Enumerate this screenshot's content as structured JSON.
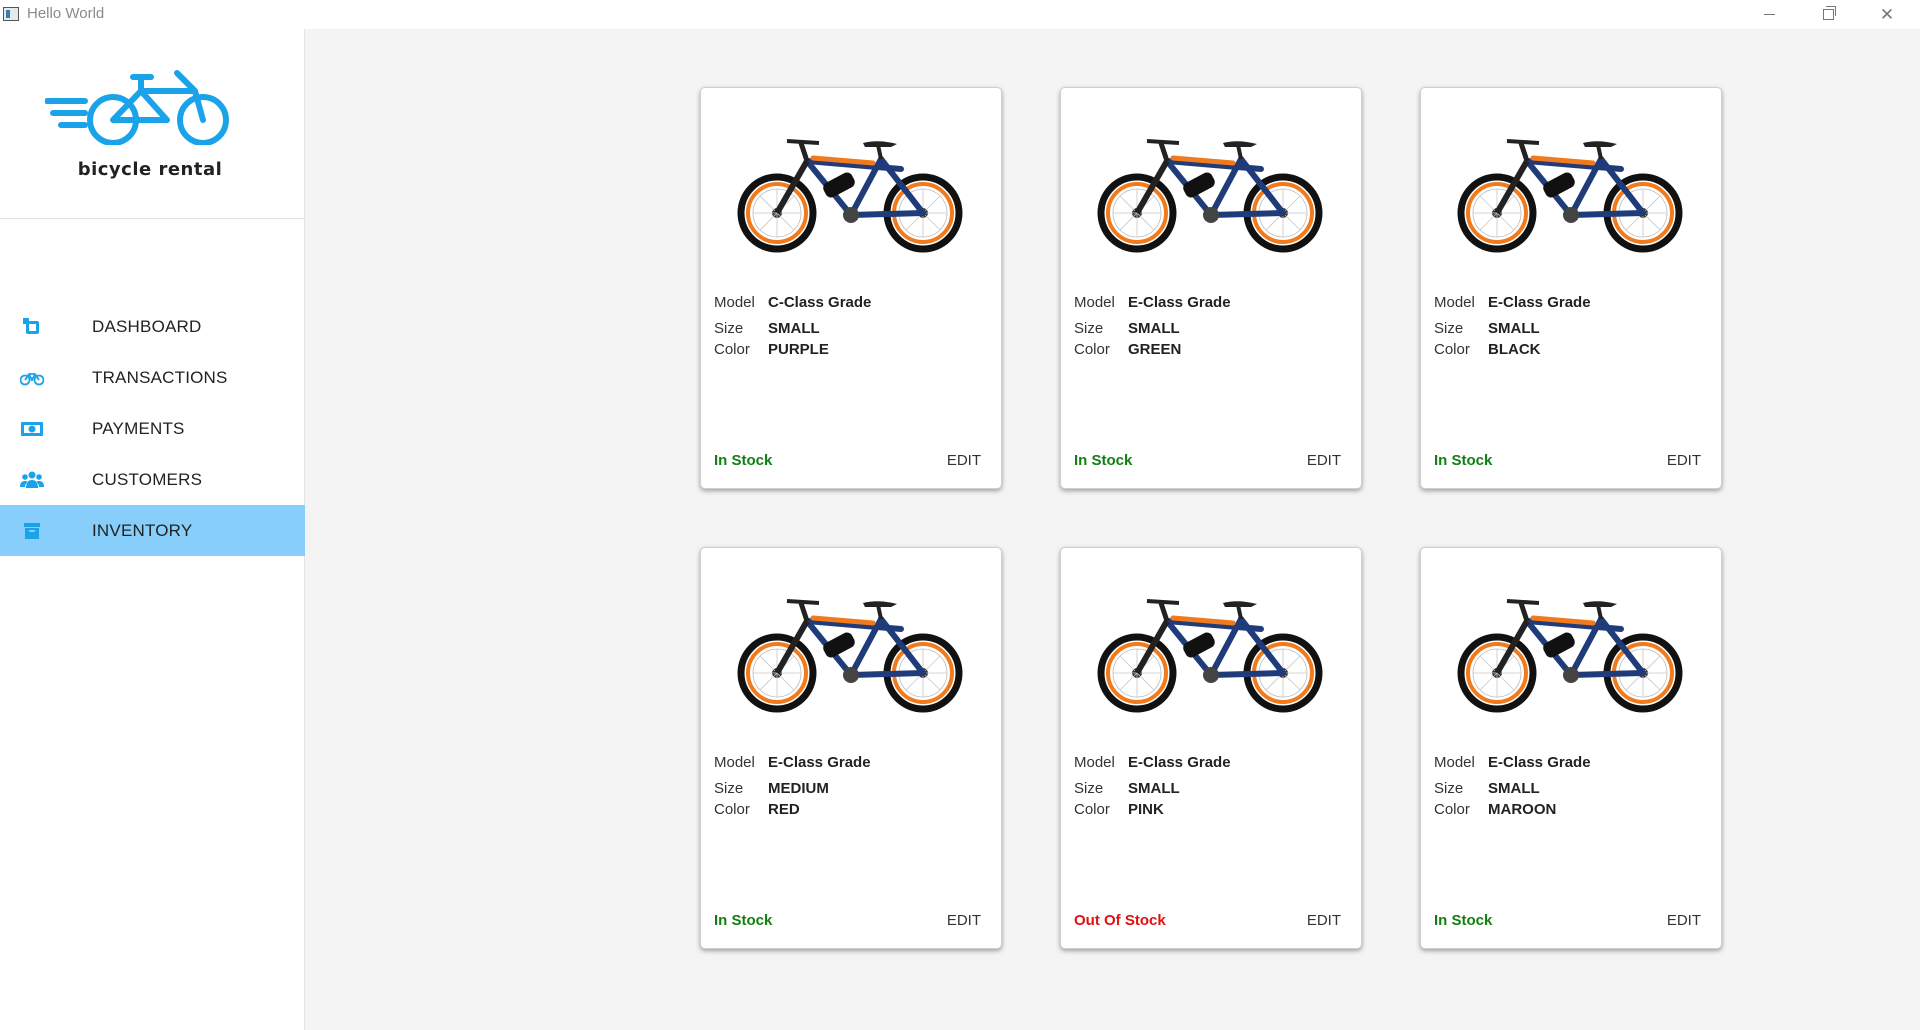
{
  "window": {
    "title": "Hello World",
    "controls": {
      "minimize": "minimize-icon",
      "maximize": "restore-icon",
      "close": "close-icon"
    }
  },
  "brand": {
    "name": "bicycle rental",
    "logo_icon": "bicycle-logo-icon",
    "accent": "#1aa3e8"
  },
  "nav": {
    "active_color": "#87cefa",
    "items": [
      {
        "label": "DASHBOARD",
        "icon": "dashboard-icon"
      },
      {
        "label": "TRANSACTIONS",
        "icon": "bicycle-icon"
      },
      {
        "label": "PAYMENTS",
        "icon": "money-icon"
      },
      {
        "label": "CUSTOMERS",
        "icon": "users-icon"
      },
      {
        "label": "INVENTORY",
        "icon": "archive-icon",
        "active": true
      }
    ]
  },
  "inventory": {
    "labels": {
      "model": "Model",
      "size": "Size",
      "color": "Color",
      "edit": "EDIT"
    },
    "in_stock_color": "#118011",
    "out_of_stock_color": "#e01010",
    "cards": [
      {
        "model": "C-Class Grade",
        "size": "SMALL",
        "color": "PURPLE",
        "stock": "In Stock",
        "in_stock": true
      },
      {
        "model": "E-Class Grade",
        "size": "SMALL",
        "color": "GREEN",
        "stock": "In Stock",
        "in_stock": true
      },
      {
        "model": "E-Class Grade",
        "size": "SMALL",
        "color": "BLACK",
        "stock": "In Stock",
        "in_stock": true
      },
      {
        "model": "E-Class Grade",
        "size": "MEDIUM",
        "color": "RED",
        "stock": "In Stock",
        "in_stock": true
      },
      {
        "model": "E-Class Grade",
        "size": "SMALL",
        "color": "PINK",
        "stock": "Out Of Stock",
        "in_stock": false
      },
      {
        "model": "E-Class Grade",
        "size": "SMALL",
        "color": "MAROON",
        "stock": "In Stock",
        "in_stock": true
      }
    ]
  }
}
